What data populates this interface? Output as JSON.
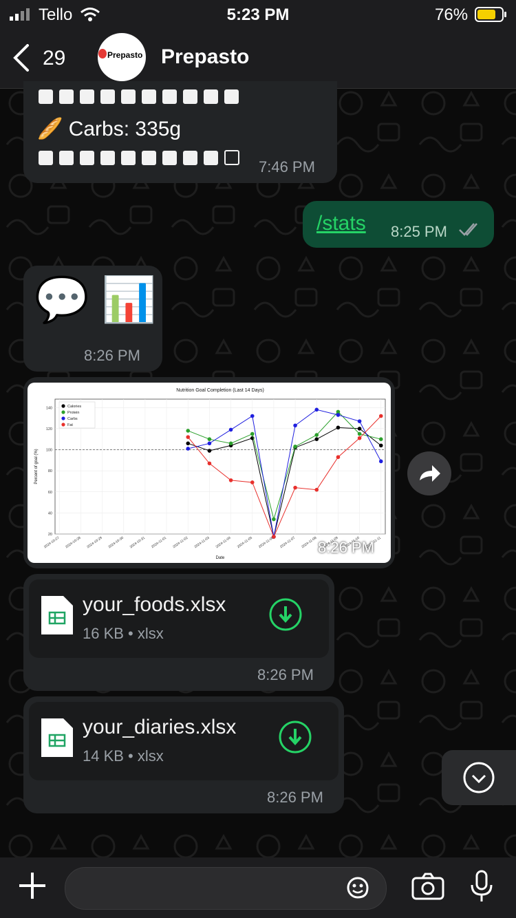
{
  "status_bar": {
    "carrier": "Tello",
    "time": "5:23 PM",
    "battery_pct": "76%"
  },
  "header": {
    "back_count": "29",
    "avatar_text": "Prepasto",
    "title": "Prepasto"
  },
  "messages": {
    "m1": {
      "carbs_text": "🥖 Carbs: 335g",
      "time": "7:46 PM"
    },
    "m2": {
      "text": "/stats",
      "time": "8:25 PM"
    },
    "m3": {
      "emoji": "💬 📊",
      "time": "8:26 PM"
    },
    "m4": {
      "time": "8:26 PM"
    },
    "file1": {
      "name": "your_foods.xlsx",
      "meta": "16 KB • xlsx",
      "time": "8:26 PM"
    },
    "file2": {
      "name": "your_diaries.xlsx",
      "meta": "14 KB • xlsx",
      "time": "8:26 PM"
    }
  },
  "chart_data": {
    "type": "line",
    "title": "Nutrition Goal Completion (Last 14 Days)",
    "xlabel": "Date",
    "ylabel": "Percent of goal (%)",
    "ylim": [
      20,
      148
    ],
    "yticks": [
      20,
      40,
      60,
      80,
      100,
      120,
      140
    ],
    "categories": [
      "2024-10-27",
      "2024-10-28",
      "2024-10-29",
      "2024-10-30",
      "2024-10-31",
      "2024-11-01",
      "2024-11-02",
      "2024-11-03",
      "2024-11-04",
      "2024-11-05",
      "2024-11-06",
      "2024-11-07",
      "2024-11-08",
      "2024-11-09",
      "2024-11-10",
      "2024-11-11"
    ],
    "reference_line": 100,
    "grid": true,
    "legend": "top-left",
    "series": [
      {
        "name": "Calories",
        "color": "#000000",
        "values": [
          null,
          null,
          null,
          null,
          null,
          null,
          106,
          99,
          104,
          111,
          17,
          102,
          110,
          121,
          120,
          104
        ]
      },
      {
        "name": "Protein",
        "color": "#2ca02c",
        "values": [
          null,
          null,
          null,
          null,
          null,
          null,
          118,
          110,
          106,
          115,
          34,
          103,
          114,
          136,
          115,
          110
        ]
      },
      {
        "name": "Carbs",
        "color": "#1f1fdf",
        "values": [
          null,
          null,
          null,
          null,
          null,
          null,
          101,
          106,
          119,
          132,
          10,
          123,
          138,
          133,
          127,
          89
        ]
      },
      {
        "name": "Fat",
        "color": "#e8302c",
        "values": [
          null,
          null,
          null,
          null,
          null,
          null,
          112,
          87,
          71,
          69,
          13,
          64,
          62,
          93,
          111,
          132
        ]
      }
    ]
  }
}
